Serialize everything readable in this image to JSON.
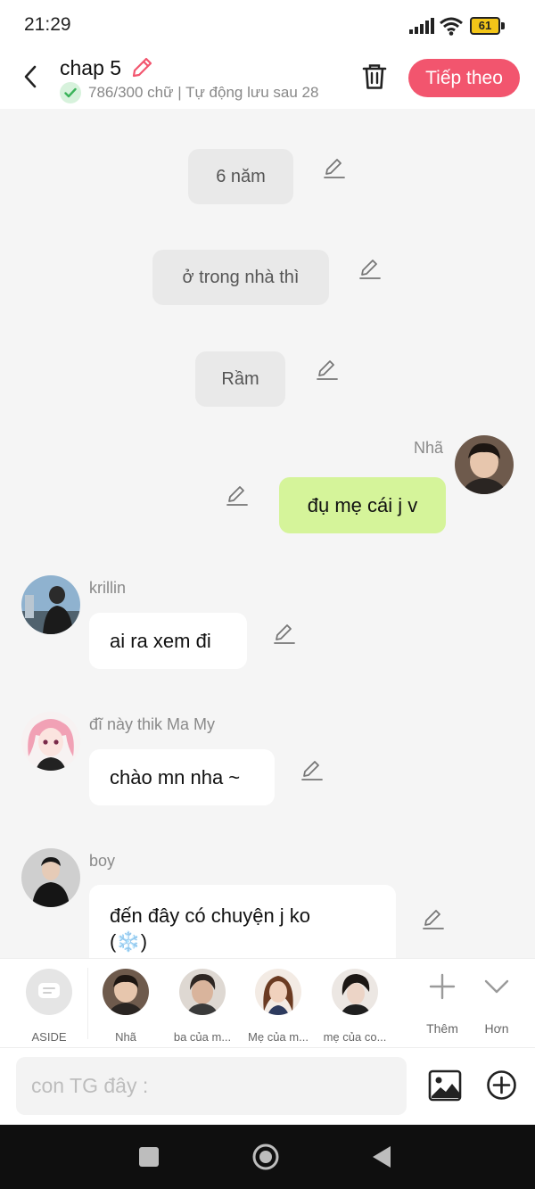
{
  "status_bar": {
    "time": "21:29",
    "battery": "61"
  },
  "header": {
    "title": "chap 5",
    "status_text": "786/300 chữ | Tự động lưu sau 28",
    "next_button": "Tiếp theo"
  },
  "messages": {
    "narration_1": "6 năm",
    "narration_2": "ở trong nhà thì",
    "narration_3": "Rầm",
    "nha": {
      "sender": "Nhã",
      "text": "đụ mẹ cái j v"
    },
    "krillin": {
      "sender": "krillin",
      "text": "ai ra xem đi"
    },
    "mamy": {
      "sender": "đĩ này thik Ma My",
      "text": "chào mn nha ~"
    },
    "boy": {
      "sender": "boy",
      "text_line1": "đến đây có chuyện j ko",
      "text_line2": "(❄️)"
    }
  },
  "characters": [
    {
      "label": "ASIDE"
    },
    {
      "label": "Nhã"
    },
    {
      "label": "ba của m..."
    },
    {
      "label": "Mẹ của m..."
    },
    {
      "label": "mẹ của co..."
    }
  ],
  "tools": {
    "more_label": "Thêm",
    "expand_label": "Hơn"
  },
  "input": {
    "placeholder": "con TG đây :"
  },
  "colors": {
    "accent": "#f2556e",
    "own_bubble": "#d5f49a",
    "narration_bubble": "#e9e9e9"
  }
}
